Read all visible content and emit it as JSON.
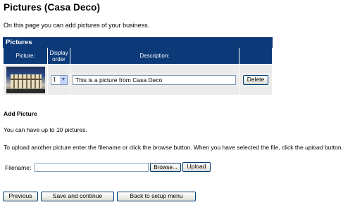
{
  "page": {
    "title": "Pictures (Casa Deco)",
    "intro": "On this page you can add pictures of your business."
  },
  "pictures_table": {
    "title": "Pictures",
    "headers": {
      "picture": "Picture:",
      "display_order": "Display order",
      "description": "Description:"
    },
    "rows": [
      {
        "thumbnail_icon": "building-photo-thumbnail",
        "order": "1",
        "description": "This is a picture from Casa Deco",
        "delete_label": "Delete"
      }
    ]
  },
  "add_picture": {
    "title": "Add Picture",
    "limit_text": "You can have up to 10 pictures.",
    "upload_text_1": "To upload another picture enter the filename or click the ",
    "upload_browse_word": "browse",
    "upload_text_2": " button. When you have selected the file, click the ",
    "upload_upload_word": "upload",
    "upload_text_3": " button.",
    "filename_label": "Filename:",
    "filename_value": "",
    "browse_label": "Browse...",
    "upload_label": "Upload"
  },
  "footer": {
    "previous_label": "Previous",
    "save_label": "Save and continue",
    "setup_label": "Back to setup menu"
  }
}
